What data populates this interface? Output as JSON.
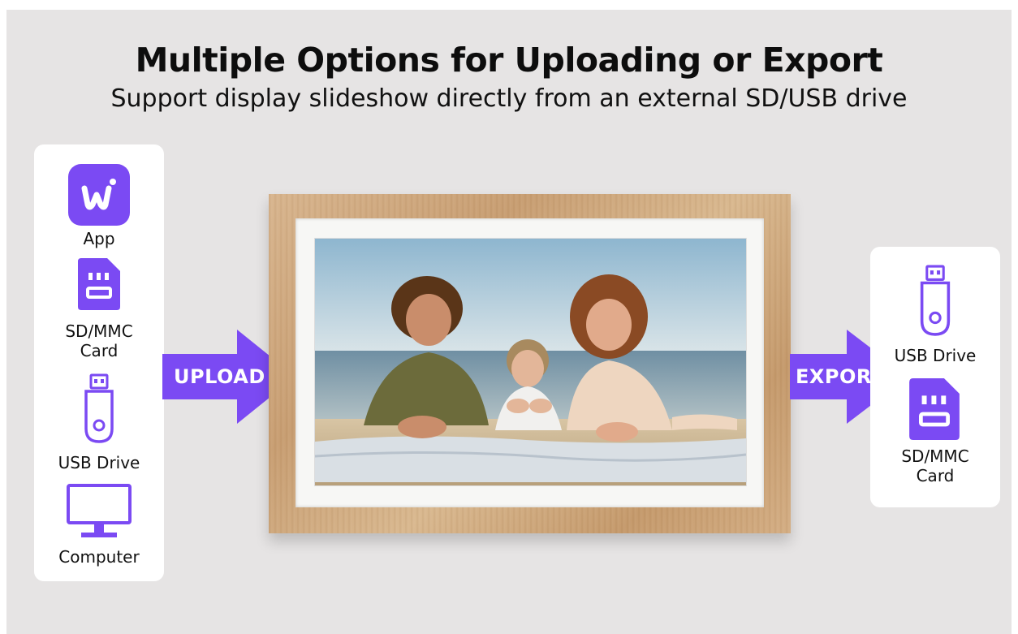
{
  "headline": {
    "title": "Multiple Options for Uploading or Export",
    "subtitle": "Support display slideshow directly from an external SD/USB drive"
  },
  "upload_sources": [
    {
      "label": "App",
      "icon": "app-icon"
    },
    {
      "label": "SD/MMC\nCard",
      "icon": "sd-card-icon"
    },
    {
      "label": "USB Drive",
      "icon": "usb-drive-icon"
    },
    {
      "label": "Computer",
      "icon": "computer-monitor-icon"
    }
  ],
  "upload_arrow": {
    "label": "UPLOAD",
    "icon": "arrow-right-icon"
  },
  "export_arrow": {
    "label": "EXPORT",
    "icon": "arrow-right-icon"
  },
  "export_targets": [
    {
      "label": "USB Drive",
      "icon": "usb-drive-icon"
    },
    {
      "label": "SD/MMC\nCard",
      "icon": "sd-card-icon"
    }
  ],
  "photo_frame": {
    "photo": "family-beach-photo"
  },
  "colors": {
    "accent": "#7b4af3",
    "background": "#e6e4e4",
    "panel": "#ffffff",
    "text": "#111111",
    "frame_wood": "#cfa77b"
  }
}
